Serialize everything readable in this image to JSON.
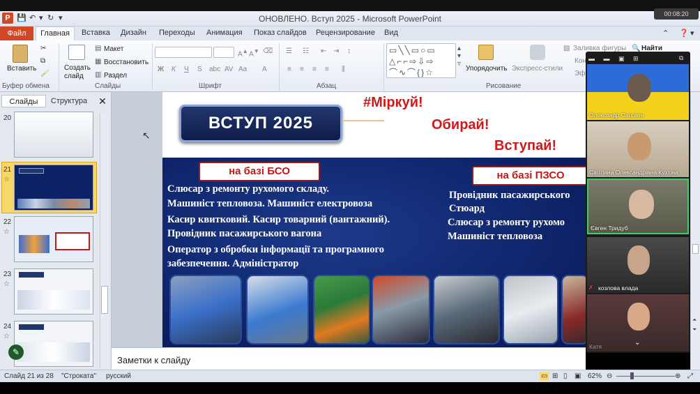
{
  "window": {
    "title": "ОНОВЛЕНО. Вступ 2025  -  Microsoft PowerPoint",
    "timer": "00:08:20"
  },
  "ribbon_tabs": [
    "Файл",
    "Главная",
    "Вставка",
    "Дизайн",
    "Переходы",
    "Анимация",
    "Показ слайдов",
    "Рецензирование",
    "Вид"
  ],
  "ribbon": {
    "paste": "Вставить",
    "create_slide": "Создать слайд",
    "layout": "Макет",
    "restore": "Восстановить",
    "section": "Раздел",
    "arrange": "Упорядочить",
    "quick_styles": "Экспресс-стили",
    "shape_fill": "Заливка фигуры",
    "find": "Найти",
    "shape_outline_short": "Кон",
    "effects_short": "Эф",
    "groups": {
      "clipboard": "Буфер обмена",
      "slides": "Слайды",
      "font": "Шрифт",
      "paragraph": "Абзац",
      "drawing": "Рисование"
    }
  },
  "left_panel": {
    "tab_slides": "Слайды",
    "tab_outline": "Структура",
    "thumbs": [
      {
        "num": "20"
      },
      {
        "num": "21"
      },
      {
        "num": "22"
      },
      {
        "num": "23"
      },
      {
        "num": "24"
      }
    ]
  },
  "slide": {
    "title": "ВСТУП 2025",
    "slogans": [
      "#Міркуй!",
      "Обирай!",
      "Вступай!"
    ],
    "base_bso": "на базі БСО",
    "base_pzso": "на базі ПЗСО",
    "left_lines": [
      "Слюсар з ремонту рухомого складу.",
      "Машиніст тепловоза. Машиніст електровоза",
      "Касир квитковий.  Касир товарний (вантажний).",
      "Провідник  пасажирського вагона",
      "Оператор з обробки інформації   та програмного",
      "забезпечення. Адміністратор"
    ],
    "right_lines": [
      "Провідник  пасажирського",
      "Стюард",
      "Слюсар з ремонту рухомо",
      "Машиніст тепловоза"
    ]
  },
  "notes_placeholder": "Заметки к слайду",
  "status": {
    "slide_info": "Слайд 21 из 28",
    "theme": "\"Строката\"",
    "language": "русский",
    "zoom": "62%"
  },
  "video": {
    "participants": [
      {
        "name": "Олександр Сапрікін"
      },
      {
        "name": "Світлана Олександрівна Кухтіна"
      },
      {
        "name": "Євген Тридуб"
      },
      {
        "name": "козлова влада"
      },
      {
        "name": "Катя"
      }
    ]
  },
  "colors": {
    "accent_red": "#d24726",
    "slide_blue": "#0d2166",
    "slogan_red": "#d01818"
  }
}
